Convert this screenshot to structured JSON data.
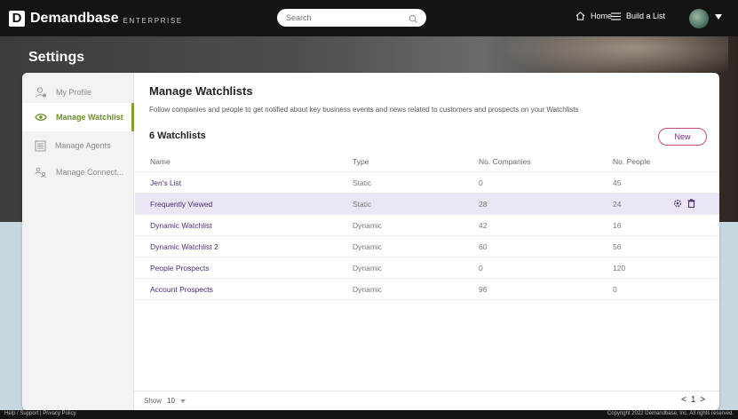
{
  "topbar": {
    "brand": "Demandbase",
    "brand_sub": "ENTERPRISE",
    "logo_letter": "D",
    "search_placeholder": "Search",
    "home_label": "Home",
    "build_label": "Build a List"
  },
  "page": {
    "title": "Settings"
  },
  "sidebar": {
    "items": [
      {
        "label": "My Profile",
        "icon": "profile-icon"
      },
      {
        "label": "Manage Watchlist",
        "icon": "eye-icon",
        "active": true
      },
      {
        "label": "Manage Agents",
        "icon": "agents-icon"
      },
      {
        "label": "Manage Connect...",
        "icon": "connect-icon"
      }
    ]
  },
  "main": {
    "heading": "Manage Watchlists",
    "description": "Follow companies and people to get notified about key business events and news related to customers and prospects on your Watchlists",
    "count_label": "6 Watchlists",
    "new_label": "New",
    "columns": [
      "Name",
      "Type",
      "No. Companies",
      "No. People"
    ],
    "rows": [
      {
        "name": "Jen's List",
        "type": "Static",
        "companies": "0",
        "people": "45"
      },
      {
        "name": "Frequently Viewed",
        "type": "Static",
        "companies": "28",
        "people": "24",
        "highlighted": true
      },
      {
        "name": "Dynamic Watchlist",
        "type": "Dynamic",
        "companies": "42",
        "people": "16"
      },
      {
        "name": "Dynamic Watchlist 2",
        "type": "Dynamic",
        "companies": "60",
        "people": "56"
      },
      {
        "name": "People Prospects",
        "type": "Dynamic",
        "companies": "0",
        "people": "120"
      },
      {
        "name": "Account Prospects",
        "type": "Dynamic",
        "companies": "96",
        "people": "0"
      }
    ],
    "footer": {
      "show_label": "Show",
      "show_value": "10",
      "page": "1",
      "prev": "<",
      "next": ">"
    }
  },
  "bottombar": {
    "left": "Help / Support | Privacy Policy",
    "right": "Copyright 2022 Demandbase, Inc. All rights reserved."
  },
  "colors": {
    "accent_green": "#7ea32a",
    "link_purple": "#4a2d7a",
    "highlight_row": "#ece5f5",
    "new_button_border": "#c0487a"
  }
}
